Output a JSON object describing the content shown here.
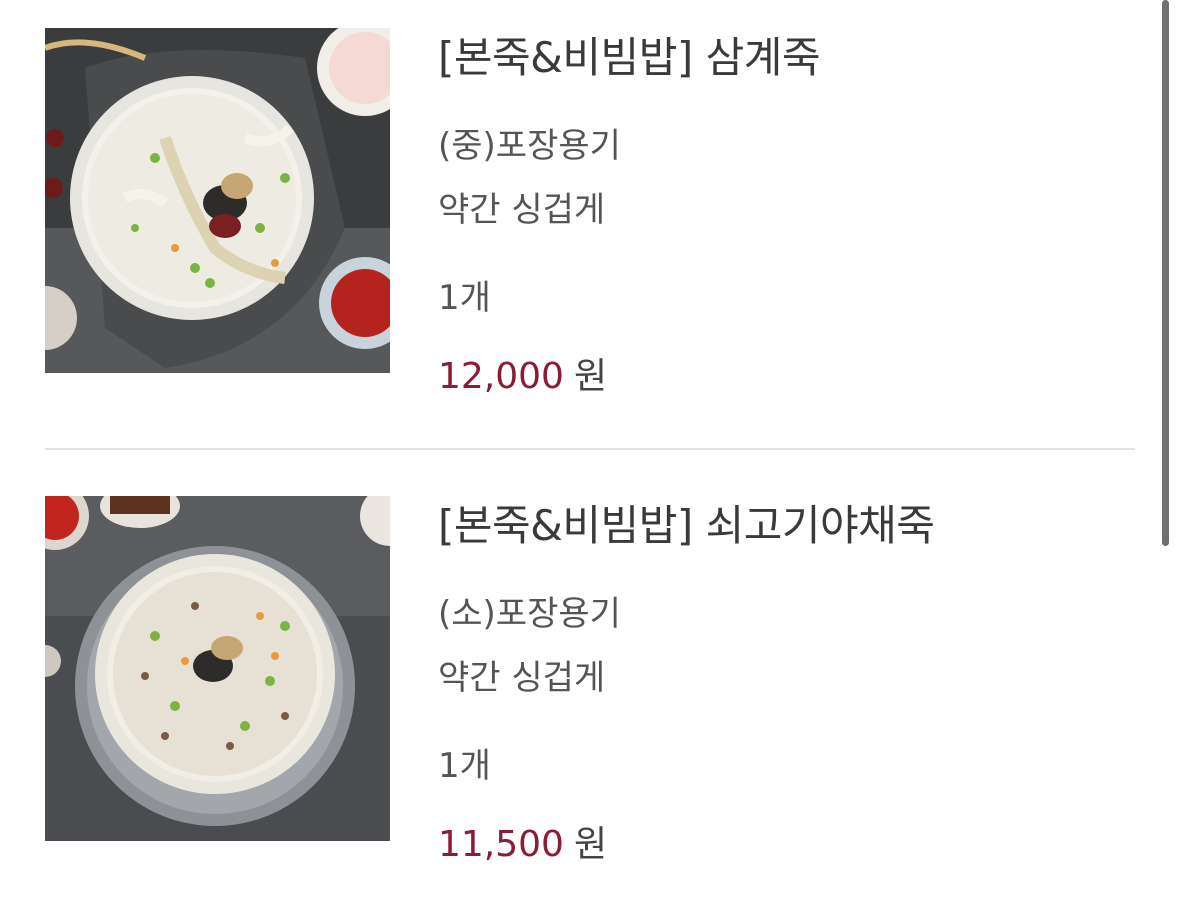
{
  "cart": {
    "items": [
      {
        "title": "[본죽&비빔밥] 삼계죽",
        "image_alt": "삼계죽 product image",
        "option_container": "(중)포장용기",
        "option_taste": "약간 싱겁게",
        "quantity": "1개",
        "price_amount": "12,000",
        "price_unit": "원"
      },
      {
        "title": "[본죽&비빔밥] 쇠고기야채죽",
        "image_alt": "쇠고기야채죽 product image",
        "option_container": "(소)포장용기",
        "option_taste": "약간 싱겁게",
        "quantity": "1개",
        "price_amount": "11,500",
        "price_unit": "원"
      }
    ]
  },
  "colors": {
    "price_accent": "#8a1c34",
    "text_primary": "#3a3a3a",
    "text_secondary": "#555555",
    "divider": "#e1e1e1"
  }
}
